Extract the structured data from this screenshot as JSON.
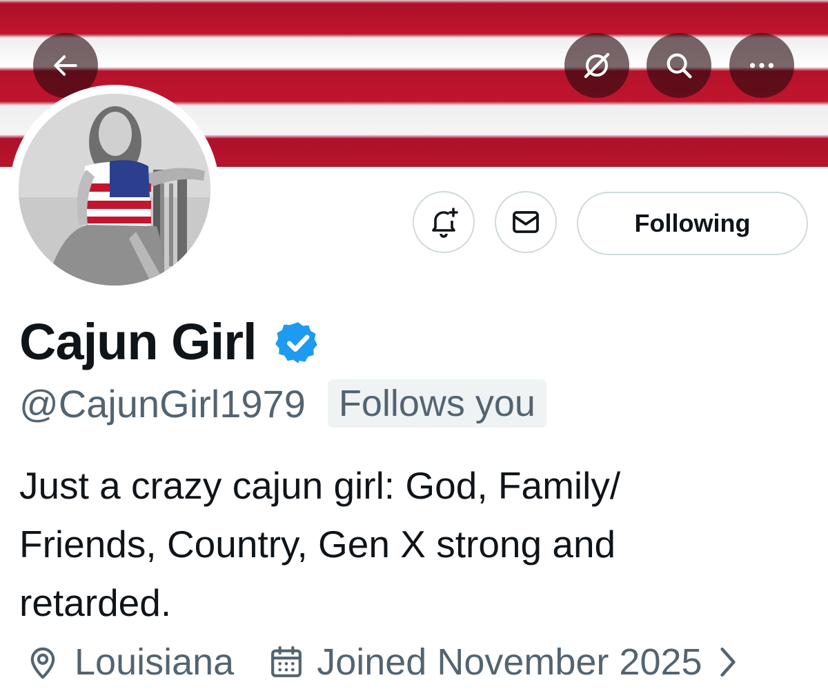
{
  "header": {
    "back_icon": "arrow-left-icon",
    "grok_icon": "grok-icon",
    "search_icon": "search-icon",
    "more_icon": "more-horizontal-icon",
    "banner_colors": [
      "#c4152f",
      "#ffffff"
    ]
  },
  "profile": {
    "display_name": "Cajun Girl",
    "verified": true,
    "verified_color": "#1d9bf0",
    "handle": "@CajunGirl1979",
    "follows_you_label": "Follows you",
    "bio": "Just a crazy cajun girl: God, Family/ Friends, Country, Gen X strong and retarded.",
    "location": "Louisiana",
    "joined": "Joined November 2025"
  },
  "actions": {
    "notify_icon": "bell-plus-icon",
    "message_icon": "envelope-icon",
    "following_label": "Following"
  },
  "colors": {
    "text_primary": "#0f1419",
    "text_secondary": "#536471",
    "border": "#cfd9de"
  }
}
